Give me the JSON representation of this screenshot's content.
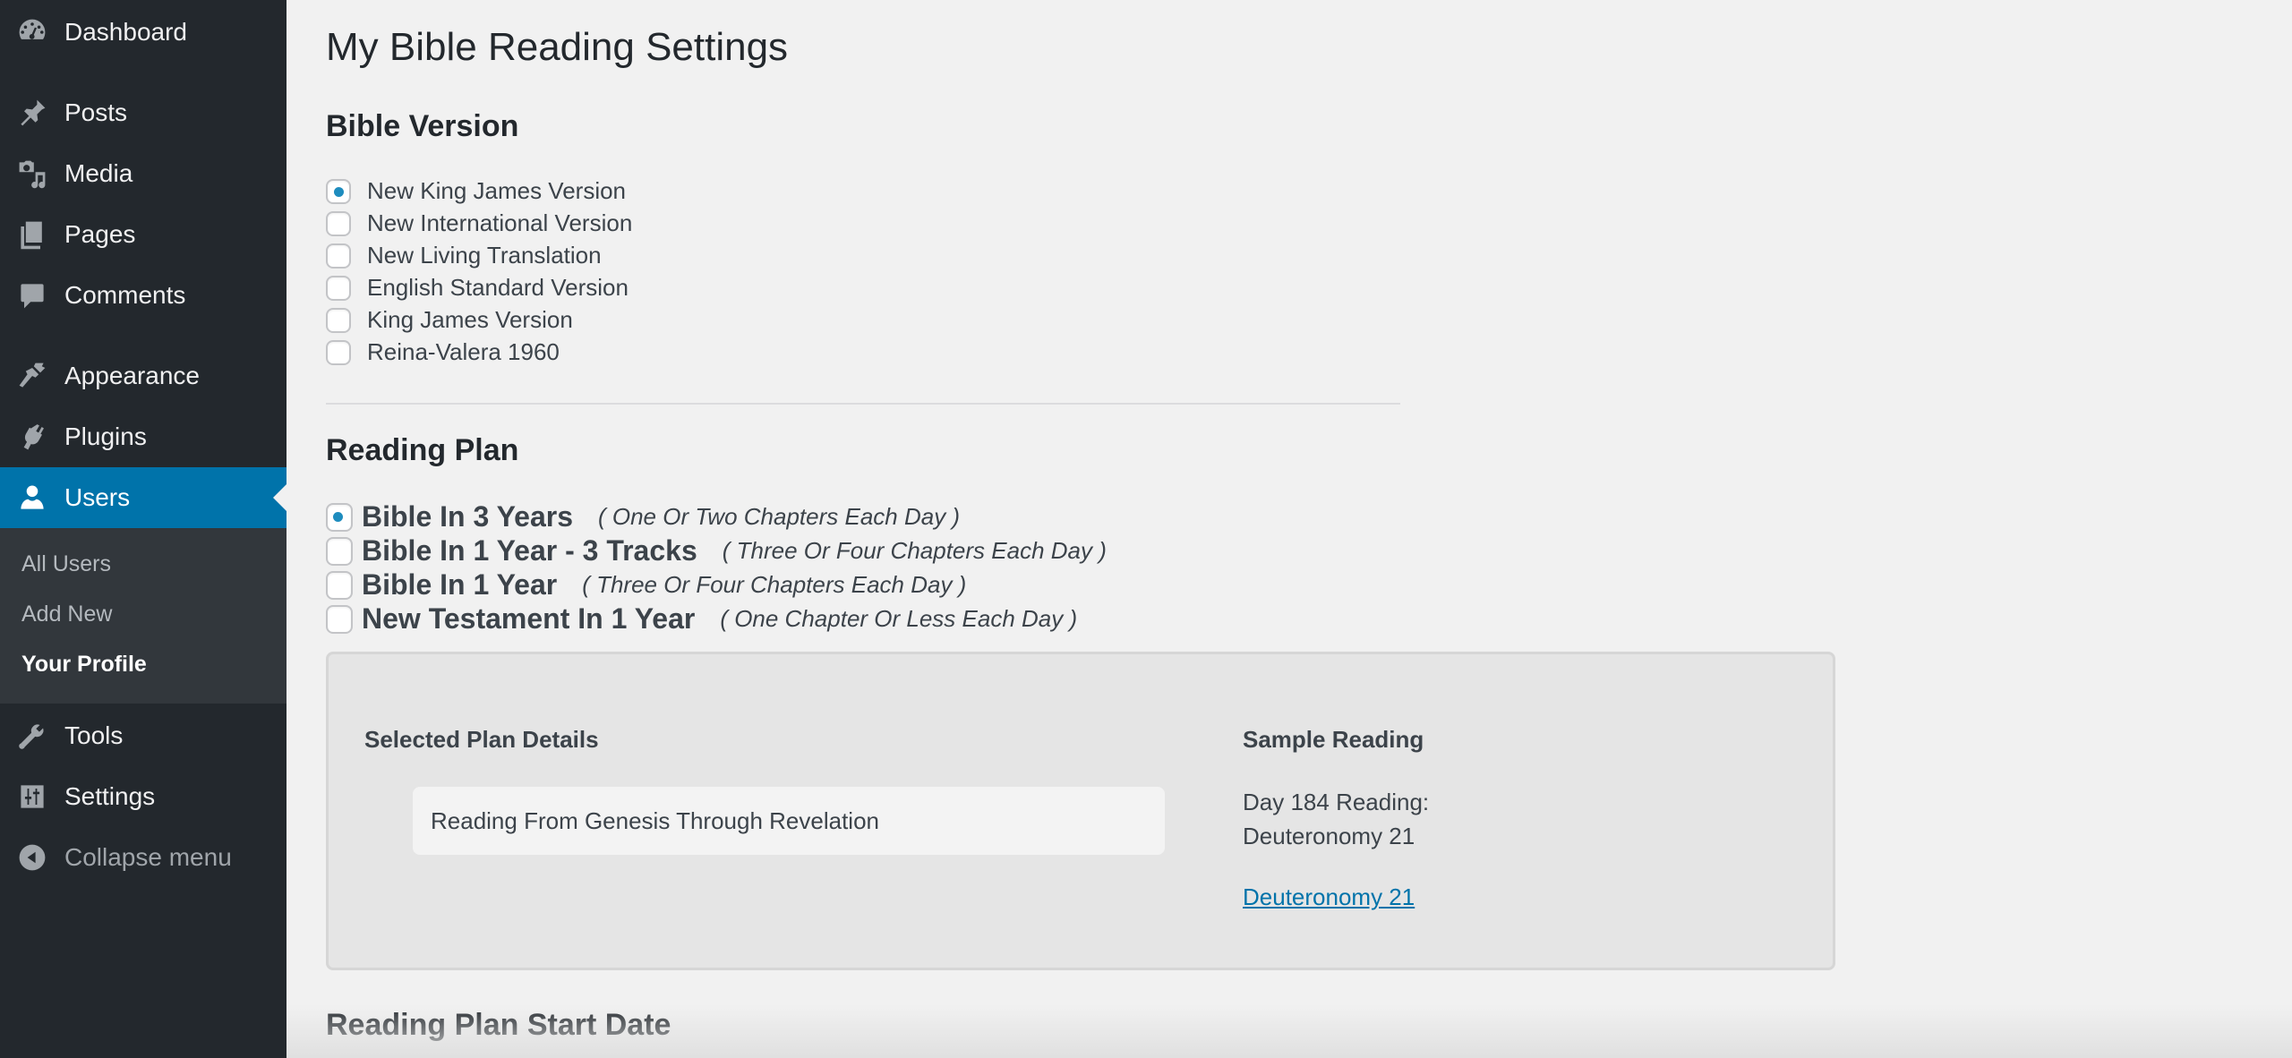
{
  "sidebar": {
    "items": [
      {
        "label": "Dashboard",
        "icon": "dashboard-icon"
      },
      {
        "label": "Posts",
        "icon": "pushpin-icon"
      },
      {
        "label": "Media",
        "icon": "media-icon"
      },
      {
        "label": "Pages",
        "icon": "pages-icon"
      },
      {
        "label": "Comments",
        "icon": "comment-icon"
      },
      {
        "label": "Appearance",
        "icon": "paintbrush-icon"
      },
      {
        "label": "Plugins",
        "icon": "plugin-icon"
      },
      {
        "label": "Users",
        "icon": "user-icon",
        "current": true
      },
      {
        "label": "Tools",
        "icon": "wrench-icon"
      },
      {
        "label": "Settings",
        "icon": "settings-sliders-icon"
      },
      {
        "label": "Collapse menu",
        "icon": "collapse-arrow-icon"
      }
    ],
    "users_submenu": [
      {
        "label": "All Users"
      },
      {
        "label": "Add New"
      },
      {
        "label": "Your Profile",
        "current": true
      }
    ],
    "accent_color": "#0073aa"
  },
  "page": {
    "title": "My Bible Reading Settings"
  },
  "bible_version": {
    "heading": "Bible Version",
    "selected": "New King James Version",
    "options": [
      {
        "label": "New King James Version",
        "checked": true
      },
      {
        "label": "New International Version",
        "checked": false
      },
      {
        "label": "New Living Translation",
        "checked": false
      },
      {
        "label": "English Standard Version",
        "checked": false
      },
      {
        "label": "King James Version",
        "checked": false
      },
      {
        "label": "Reina-Valera 1960",
        "checked": false
      }
    ]
  },
  "reading_plan": {
    "heading": "Reading Plan",
    "selected": "Bible In 3 Years",
    "options": [
      {
        "name": "Bible In 3 Years",
        "description": "( One Or Two Chapters Each Day )",
        "checked": true
      },
      {
        "name": "Bible In 1 Year - 3 Tracks",
        "description": "( Three Or Four Chapters Each Day )",
        "checked": false
      },
      {
        "name": "Bible In 1 Year",
        "description": "( Three Or Four Chapters Each Day )",
        "checked": false
      },
      {
        "name": "New Testament In 1 Year",
        "description": "( One Chapter Or Less Each Day )",
        "checked": false
      }
    ]
  },
  "plan_panel": {
    "details_heading": "Selected Plan Details",
    "details_text": "Reading From Genesis Through Revelation",
    "sample_heading": "Sample Reading",
    "sample_day": "Day 184 Reading:",
    "sample_passage": "Deuteronomy 21",
    "sample_link": "Deuteronomy 21"
  },
  "start_date": {
    "heading": "Reading Plan Start Date"
  }
}
